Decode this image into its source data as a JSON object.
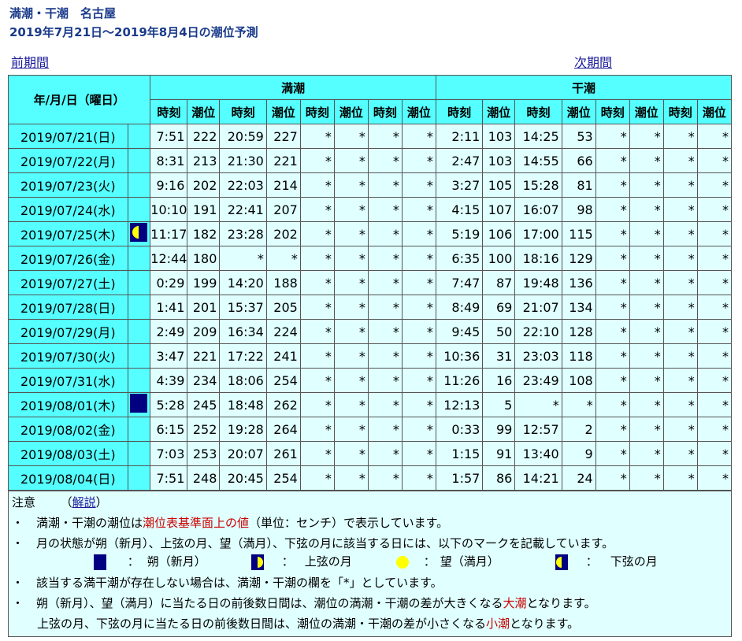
{
  "header": {
    "title": "満潮・干潮　名古屋",
    "subtitle": "2019年7月21日～2019年8月4日の潮位予測"
  },
  "nav": {
    "prev": "前期間",
    "next": "次期間"
  },
  "table": {
    "date_header": "年/月/日（曜日）",
    "high_header": "満潮",
    "low_header": "干潮",
    "time_label": "時刻",
    "level_label": "潮位",
    "rows": [
      {
        "date": "2019/07/21(日)",
        "moon": "",
        "high": [
          "7:51",
          "222",
          "20:59",
          "227",
          "*",
          "*",
          "*",
          "*"
        ],
        "low": [
          "2:11",
          "103",
          "14:25",
          "53",
          "*",
          "*",
          "*",
          "*"
        ]
      },
      {
        "date": "2019/07/22(月)",
        "moon": "",
        "high": [
          "8:31",
          "213",
          "21:30",
          "221",
          "*",
          "*",
          "*",
          "*"
        ],
        "low": [
          "2:47",
          "103",
          "14:55",
          "66",
          "*",
          "*",
          "*",
          "*"
        ]
      },
      {
        "date": "2019/07/23(火)",
        "moon": "",
        "high": [
          "9:16",
          "202",
          "22:03",
          "214",
          "*",
          "*",
          "*",
          "*"
        ],
        "low": [
          "3:27",
          "105",
          "15:28",
          "81",
          "*",
          "*",
          "*",
          "*"
        ]
      },
      {
        "date": "2019/07/24(水)",
        "moon": "",
        "high": [
          "10:10",
          "191",
          "22:41",
          "207",
          "*",
          "*",
          "*",
          "*"
        ],
        "low": [
          "4:15",
          "107",
          "16:07",
          "98",
          "*",
          "*",
          "*",
          "*"
        ]
      },
      {
        "date": "2019/07/25(木)",
        "moon": "last-quarter",
        "high": [
          "11:17",
          "182",
          "23:28",
          "202",
          "*",
          "*",
          "*",
          "*"
        ],
        "low": [
          "5:19",
          "106",
          "17:00",
          "115",
          "*",
          "*",
          "*",
          "*"
        ]
      },
      {
        "date": "2019/07/26(金)",
        "moon": "",
        "high": [
          "12:44",
          "180",
          "*",
          "*",
          "*",
          "*",
          "*",
          "*"
        ],
        "low": [
          "6:35",
          "100",
          "18:16",
          "129",
          "*",
          "*",
          "*",
          "*"
        ]
      },
      {
        "date": "2019/07/27(土)",
        "moon": "",
        "high": [
          "0:29",
          "199",
          "14:20",
          "188",
          "*",
          "*",
          "*",
          "*"
        ],
        "low": [
          "7:47",
          "87",
          "19:48",
          "136",
          "*",
          "*",
          "*",
          "*"
        ]
      },
      {
        "date": "2019/07/28(日)",
        "moon": "",
        "high": [
          "1:41",
          "201",
          "15:37",
          "205",
          "*",
          "*",
          "*",
          "*"
        ],
        "low": [
          "8:49",
          "69",
          "21:07",
          "134",
          "*",
          "*",
          "*",
          "*"
        ]
      },
      {
        "date": "2019/07/29(月)",
        "moon": "",
        "high": [
          "2:49",
          "209",
          "16:34",
          "224",
          "*",
          "*",
          "*",
          "*"
        ],
        "low": [
          "9:45",
          "50",
          "22:10",
          "128",
          "*",
          "*",
          "*",
          "*"
        ]
      },
      {
        "date": "2019/07/30(火)",
        "moon": "",
        "high": [
          "3:47",
          "221",
          "17:22",
          "241",
          "*",
          "*",
          "*",
          "*"
        ],
        "low": [
          "10:36",
          "31",
          "23:03",
          "118",
          "*",
          "*",
          "*",
          "*"
        ]
      },
      {
        "date": "2019/07/31(水)",
        "moon": "",
        "high": [
          "4:39",
          "234",
          "18:06",
          "254",
          "*",
          "*",
          "*",
          "*"
        ],
        "low": [
          "11:26",
          "16",
          "23:49",
          "108",
          "*",
          "*",
          "*",
          "*"
        ]
      },
      {
        "date": "2019/08/01(木)",
        "moon": "new",
        "high": [
          "5:28",
          "245",
          "18:48",
          "262",
          "*",
          "*",
          "*",
          "*"
        ],
        "low": [
          "12:13",
          "5",
          "*",
          "*",
          "*",
          "*",
          "*",
          "*"
        ]
      },
      {
        "date": "2019/08/02(金)",
        "moon": "",
        "high": [
          "6:15",
          "252",
          "19:28",
          "264",
          "*",
          "*",
          "*",
          "*"
        ],
        "low": [
          "0:33",
          "99",
          "12:57",
          "2",
          "*",
          "*",
          "*",
          "*"
        ]
      },
      {
        "date": "2019/08/03(土)",
        "moon": "",
        "high": [
          "7:03",
          "253",
          "20:07",
          "261",
          "*",
          "*",
          "*",
          "*"
        ],
        "low": [
          "1:15",
          "91",
          "13:40",
          "9",
          "*",
          "*",
          "*",
          "*"
        ]
      },
      {
        "date": "2019/08/04(日)",
        "moon": "",
        "high": [
          "7:51",
          "248",
          "20:45",
          "254",
          "*",
          "*",
          "*",
          "*"
        ],
        "low": [
          "1:57",
          "86",
          "14:21",
          "24",
          "*",
          "*",
          "*",
          "*"
        ]
      }
    ]
  },
  "notes": {
    "heading": "注意",
    "explain_link": "解説",
    "explain_open": "（",
    "explain_close": "）",
    "bullet": "・",
    "line1_a": "満潮・干潮の潮位は",
    "line1_red": "潮位表基準面上の値",
    "line1_b": "（単位：センチ）で表示しています。",
    "line2": "月の状態が朔（新月）、上弦の月、望（満月）、下弦の月に該当する日には、以下のマークを記載しています。",
    "colon": "：",
    "legend_new": "朔（新月）",
    "legend_first": "上弦の月",
    "legend_full": "望（満月）",
    "legend_last": "下弦の月",
    "line3": "該当する満干潮が存在しない場合は、満潮・干潮の欄を「*」としています。",
    "line4_a": "朔（新月）、望（満月）に当たる日の前後数日間は、潮位の満潮・干潮の差が大きくなる",
    "line4_red": "大潮",
    "line4_b": "となります。",
    "line5_a": "上弦の月、下弦の月に当たる日の前後数日間は、潮位の満潮・干潮の差が小さくなる",
    "line5_red": "小潮",
    "line5_b": "となります。"
  },
  "colors": {
    "header_bg": "#55ffff",
    "cell_bg": "#e0ffff",
    "title": "#1a3a8a",
    "moon_dark": "#000080",
    "moon_light": "#ffff00",
    "accent_red": "#cc0000"
  }
}
